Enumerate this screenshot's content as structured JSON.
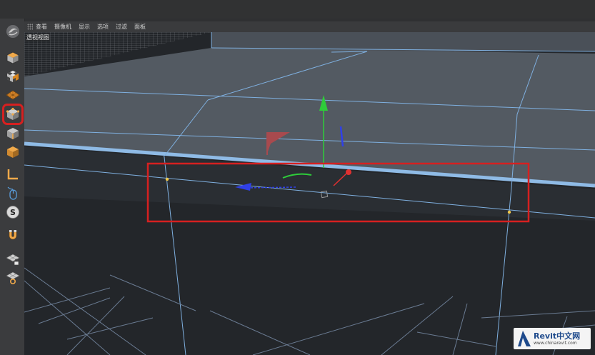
{
  "menu": {
    "items": [
      "查看",
      "摄像机",
      "显示",
      "选项",
      "过滤",
      "面板"
    ]
  },
  "viewport": {
    "label": "透视视图"
  },
  "toolbar": {
    "tools": [
      {
        "name": "model-mode-tool",
        "icon": "cube-icon"
      },
      {
        "name": "texture-mode-tool",
        "icon": "checker-cube-icon"
      },
      {
        "name": "workplane-tool",
        "icon": "workplane-icon"
      },
      {
        "name": "points-mode-tool",
        "icon": "points-cube-icon",
        "selected": true
      },
      {
        "name": "edges-mode-tool",
        "icon": "edges-cube-icon"
      },
      {
        "name": "polygons-mode-tool",
        "icon": "polygons-cube-icon"
      },
      {
        "name": "axis-tool",
        "icon": "axis-icon"
      },
      {
        "name": "tweak-tool",
        "icon": "mouse-icon"
      },
      {
        "name": "solo-tool",
        "icon": "solo-icon"
      },
      {
        "name": "snap-tool",
        "icon": "magnet-icon"
      },
      {
        "name": "workplane-lock-tool",
        "icon": "grid-lock-icon"
      },
      {
        "name": "workplane-settings-tool",
        "icon": "grid-gear-icon"
      }
    ]
  },
  "watermark": {
    "brand": "Revit中文网",
    "url": "www.chinarevit.com"
  },
  "colors": {
    "highlight_red": "#d62020",
    "edge_blue": "#7fb0e0",
    "axis_y": "#2ecc3a",
    "axis_x": "#e03030",
    "axis_z": "#3040e8"
  }
}
